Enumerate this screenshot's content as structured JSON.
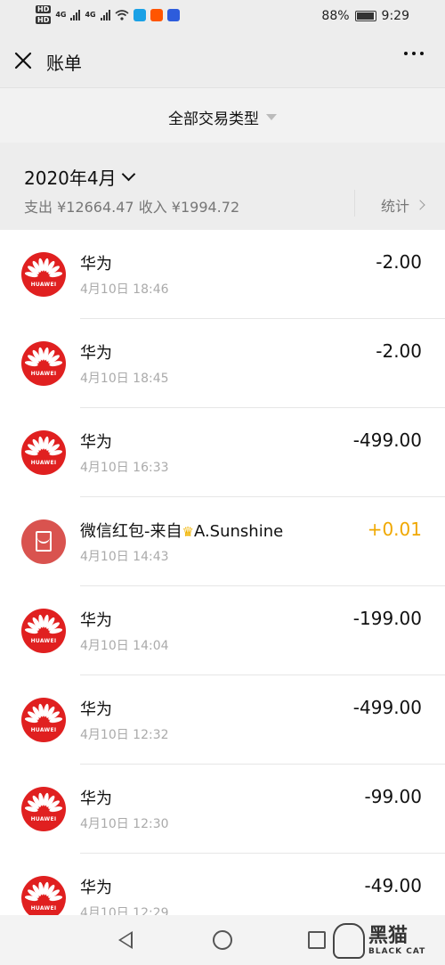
{
  "status_bar": {
    "hd1": "HD",
    "hd2": "HD",
    "net1": "4G",
    "net2": "4G",
    "battery": "88%",
    "time": "9:29"
  },
  "header": {
    "title": "账单"
  },
  "filter": {
    "label": "全部交易类型"
  },
  "month": {
    "title": "2020年4月",
    "summary": "支出 ¥12664.47 收入 ¥1994.72",
    "stats_label": "统计"
  },
  "transactions": [
    {
      "name": "华为",
      "time": "4月10日 18:46",
      "amount": "-2.00",
      "type": "huawei"
    },
    {
      "name": "华为",
      "time": "4月10日 18:45",
      "amount": "-2.00",
      "type": "huawei"
    },
    {
      "name": "华为",
      "time": "4月10日 16:33",
      "amount": "-499.00",
      "type": "huawei"
    },
    {
      "name": "微信红包-来自",
      "name_suffix": "A.Sunshine",
      "time": "4月10日 14:43",
      "amount": "+0.01",
      "type": "redpacket"
    },
    {
      "name": "华为",
      "time": "4月10日 14:04",
      "amount": "-199.00",
      "type": "huawei"
    },
    {
      "name": "华为",
      "time": "4月10日 12:32",
      "amount": "-499.00",
      "type": "huawei"
    },
    {
      "name": "华为",
      "time": "4月10日 12:30",
      "amount": "-99.00",
      "type": "huawei"
    },
    {
      "name": "华为",
      "time": "4月10日 12:29",
      "amount": "-49.00",
      "type": "huawei"
    }
  ],
  "huawei_brand": "HUAWEI",
  "watermark": {
    "big": "黑猫",
    "small": "BLACK CAT"
  },
  "colors": {
    "huawei_red": "#e02020",
    "income": "#f0a800",
    "background": "#ededed"
  }
}
